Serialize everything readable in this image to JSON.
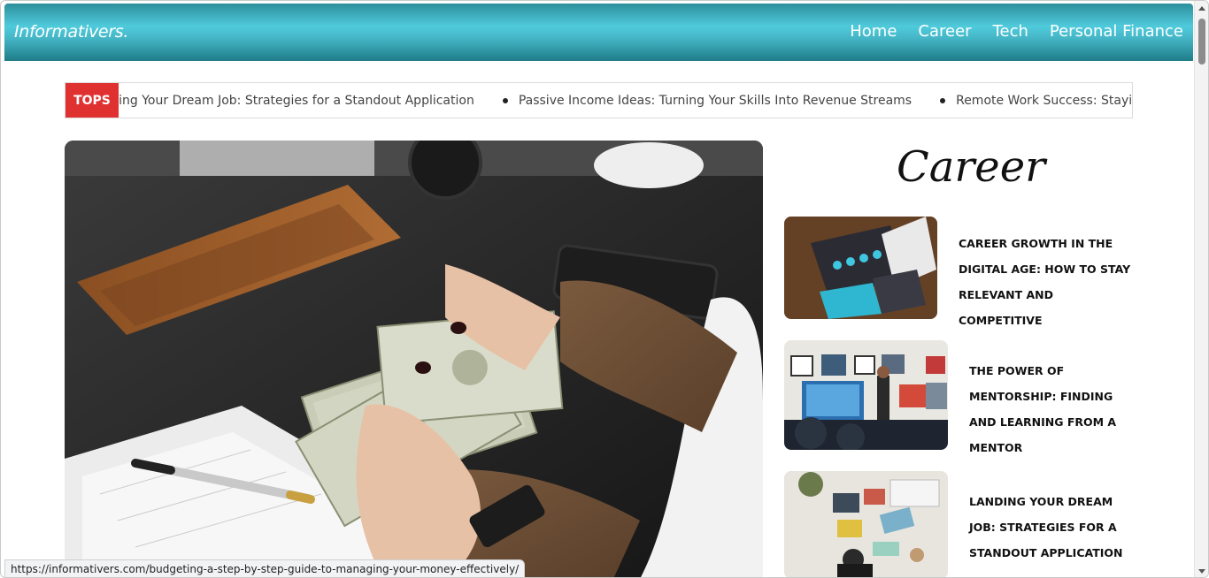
{
  "header": {
    "brand": "Informativers.",
    "nav": [
      "Home",
      "Career",
      "Tech",
      "Personal Finance"
    ]
  },
  "ticker": {
    "label": "TOPS",
    "items": [
      "Landing Your Dream Job: Strategies for a Standout Application",
      "Passive Income Ideas: Turning Your Skills Into Revenue Streams",
      "Remote Work Success: Staying Productive"
    ]
  },
  "sidebar": {
    "title": "Career",
    "articles": [
      "CAREER GROWTH IN THE DIGITAL AGE: HOW TO STAY RELEVANT AND COMPETITIVE",
      "THE POWER OF MENTORSHIP: FINDING AND LEARNING FROM A MENTOR",
      "LANDING YOUR DREAM JOB: STRATEGIES FOR A STANDOUT APPLICATION"
    ]
  },
  "status_url": "https://informativers.com/budgeting-a-step-by-step-guide-to-managing-your-money-effectively/",
  "colors": {
    "header_teal": "#45b6c6",
    "tops_red": "#e03131"
  }
}
